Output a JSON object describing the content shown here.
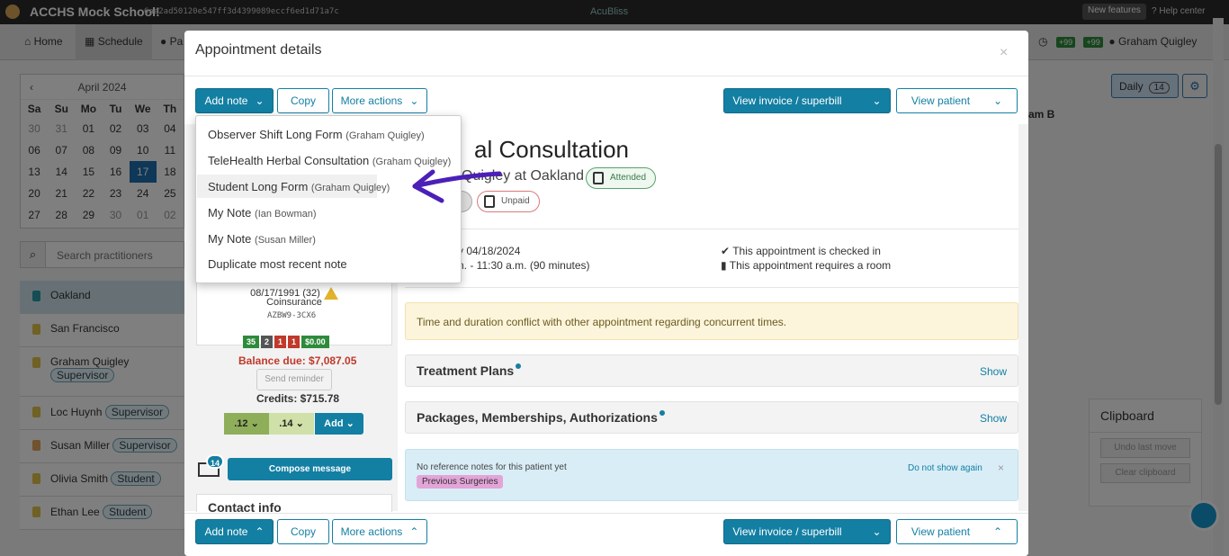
{
  "topbar": {
    "school": "ACCHS Mock School!",
    "hash": "6ae2ad50120e547ff3d4399089eccf6ed1d71a7c",
    "brand": "AcuBliss",
    "new_features": "New features",
    "help": "Help center"
  },
  "nav": {
    "home": "Home",
    "schedule": "Schedule",
    "patients": "Pa",
    "user": "Graham Quigley",
    "badge1": "+99",
    "badge2": "+99"
  },
  "calendar": {
    "month": "April 2024",
    "prev": "‹",
    "dows": [
      "Sa",
      "Su",
      "Mo",
      "Tu",
      "We",
      "Th"
    ],
    "rows": [
      [
        "30",
        "31",
        "01",
        "02",
        "03",
        "04"
      ],
      [
        "06",
        "07",
        "08",
        "09",
        "10",
        "11"
      ],
      [
        "13",
        "14",
        "15",
        "16",
        "17",
        "18"
      ],
      [
        "20",
        "21",
        "22",
        "23",
        "24",
        "25"
      ],
      [
        "27",
        "28",
        "29",
        "30",
        "01",
        "02"
      ]
    ],
    "selected": "17"
  },
  "search_practitioners": {
    "placeholder": "Search practitioners"
  },
  "locations": [
    {
      "name": "Oakland",
      "color": "#2a9aa8"
    },
    {
      "name": "San Francisco",
      "color": "#e0c24a"
    },
    {
      "name": "Graham Quigley",
      "role": "Supervisor",
      "color": "#e0c24a"
    },
    {
      "name": "Loc Huynh",
      "role": "Supervisor",
      "color": "#e0c24a"
    },
    {
      "name": "Susan Miller",
      "role": "Supervisor",
      "color": "#e0a45a"
    },
    {
      "name": "Olivia Smith",
      "role": "Student",
      "color": "#e0c24a"
    },
    {
      "name": "Ethan Lee",
      "role": "Student",
      "color": "#e0c24a"
    }
  ],
  "right": {
    "daily": "Daily",
    "daily_count": "14",
    "column_header": "am B",
    "clipboard_title": "Clipboard",
    "undo": "Undo last move",
    "clear": "Clear clipboard"
  },
  "modal": {
    "title": "Appointment details",
    "close": "×",
    "toolbar": {
      "add_note": "Add note",
      "copy": "Copy",
      "more_actions": "More actions",
      "view_invoice": "View invoice / superbill",
      "view_patient": "View patient"
    },
    "appointment": {
      "title": "al Consultation",
      "subtitle": "Quigley at Oakland",
      "attended": "Attended",
      "unpaid": "Unpaid",
      "date": "y 04/18/2024",
      "time": "n. - 11:30 a.m. (90 minutes)",
      "checked_in": "This appointment is checked in",
      "requires_room": "This appointment requires a room"
    },
    "warning": "Time and duration conflict with other appointment regarding concurrent times.",
    "sections": [
      {
        "title": "Treatment Plans",
        "action": "Show"
      },
      {
        "title": "Packages, Memberships, Authorizations",
        "action": "Show"
      }
    ],
    "reference": {
      "text": "No reference notes for this patient yet",
      "dismiss": "Do not show again",
      "close": "×",
      "tag": "Previous Surgeries"
    },
    "patient": {
      "dob": "08/17/1991 (32)",
      "insurance": "Coinsurance",
      "code": "AZBW9-3CX6",
      "chips": [
        {
          "label": "35",
          "color": "#2e8b3a"
        },
        {
          "label": "2",
          "color": "#555555"
        },
        {
          "label": "1",
          "color": "#c0392b"
        },
        {
          "label": "1",
          "color": "#c0392b"
        },
        {
          "label": "$0.00",
          "color": "#2e8b3a"
        }
      ],
      "balance": "Balance due: $7,087.05",
      "send_reminder": "Send reminder",
      "credits": "Credits: $715.78",
      "code_a": ".12",
      "code_b": ".14",
      "add": "Add",
      "messages_count": "14",
      "compose": "Compose message",
      "contact": "Contact info"
    },
    "dropdown": [
      {
        "note": "Observer Shift Long Form",
        "author": "(Graham Quigley)"
      },
      {
        "note": "TeleHealth Herbal Consultation",
        "author": "(Graham Quigley)"
      },
      {
        "note": "Student Long Form",
        "author": "(Graham Quigley)"
      },
      {
        "note": "My Note",
        "author": "(Ian Bowman)"
      },
      {
        "note": "My Note",
        "author": "(Susan Miller)"
      },
      {
        "note": "Duplicate most recent note",
        "author": ""
      }
    ]
  }
}
